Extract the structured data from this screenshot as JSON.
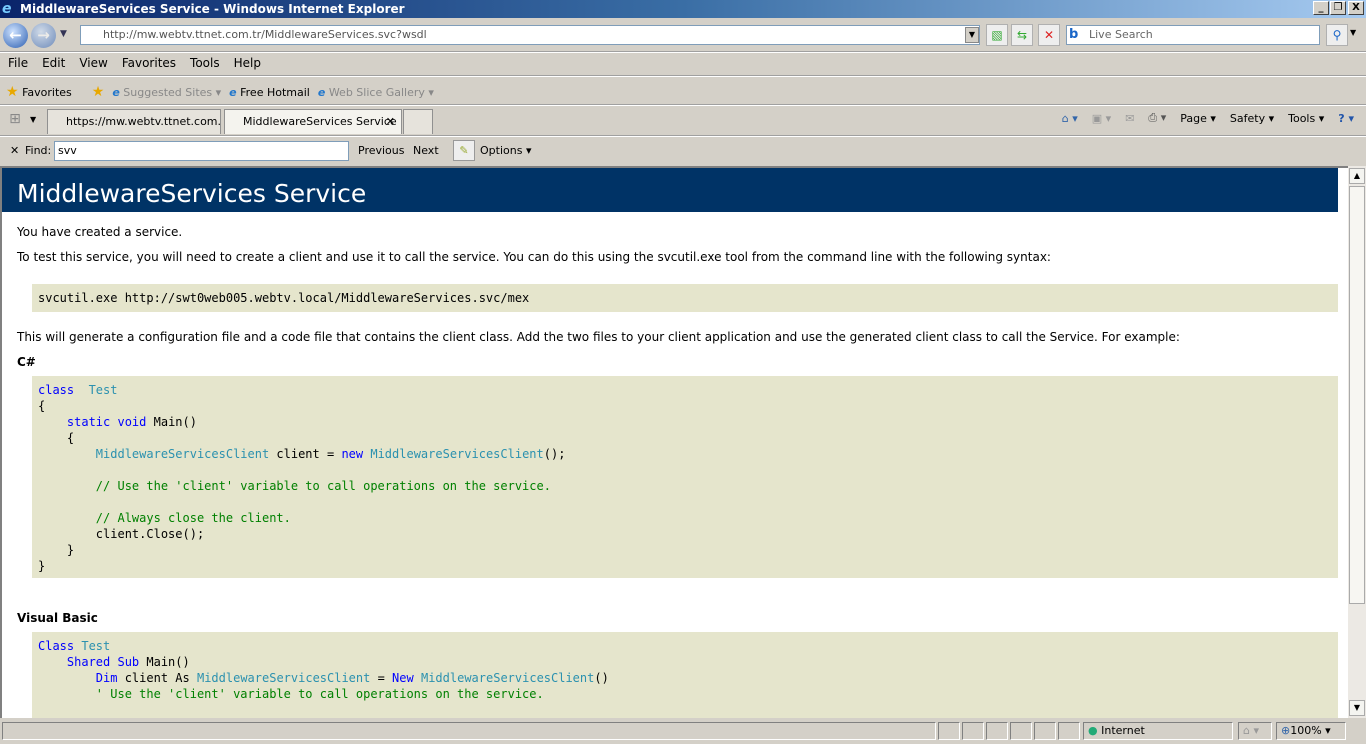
{
  "window": {
    "title": "MiddlewareServices Service - Windows Internet Explorer"
  },
  "address": {
    "url": "http://mw.webtv.ttnet.com.tr/MiddlewareServices.svc?wsdl"
  },
  "search": {
    "placeholder": "Live Search"
  },
  "menu": [
    "File",
    "Edit",
    "View",
    "Favorites",
    "Tools",
    "Help"
  ],
  "favorites": {
    "label": "Favorites",
    "items": [
      "Suggested Sites",
      "Free Hotmail",
      "Web Slice Gallery"
    ]
  },
  "tabs": [
    {
      "label": "https://mw.webtv.ttnet.com..."
    },
    {
      "label": "MiddlewareServices Service",
      "active": true
    }
  ],
  "command_bar": [
    "Page",
    "Safety",
    "Tools"
  ],
  "find": {
    "label": "Find:",
    "value": "svv",
    "previous": "Previous",
    "next": "Next",
    "options": "Options"
  },
  "page": {
    "title": "MiddlewareServices Service",
    "p1": "You have created a service.",
    "p2": "To test this service, you will need to create a client and use it to call the service. You can do this using the svcutil.exe tool from the command line with the following syntax:",
    "cmd": "svcutil.exe http://swt0web005.webtv.local/MiddlewareServices.svc/mex",
    "p3": "This will generate a configuration file and a code file that contains the client class. Add the two files to your client application and use the generated client class to call the Service. For example:",
    "csharp_heading": "C#",
    "csharp_code": [
      [
        [
          "kw",
          "class"
        ],
        [
          "",
          "  "
        ],
        [
          "ty",
          "Test"
        ]
      ],
      [
        [
          "",
          "{"
        ]
      ],
      [
        [
          "",
          "    "
        ],
        [
          "kw",
          "static void"
        ],
        [
          "",
          " Main()"
        ]
      ],
      [
        [
          "",
          "    {"
        ]
      ],
      [
        [
          "",
          "        "
        ],
        [
          "ty",
          "MiddlewareServicesClient"
        ],
        [
          "",
          " client = "
        ],
        [
          "kw",
          "new"
        ],
        [
          "",
          " "
        ],
        [
          "ty",
          "MiddlewareServicesClient"
        ],
        [
          "",
          "();"
        ]
      ],
      [
        [
          "",
          ""
        ]
      ],
      [
        [
          "",
          "        "
        ],
        [
          "cm",
          "// Use the 'client' variable to call operations on the service."
        ]
      ],
      [
        [
          "",
          ""
        ]
      ],
      [
        [
          "",
          "        "
        ],
        [
          "cm",
          "// Always close the client."
        ]
      ],
      [
        [
          "",
          "        client.Close();"
        ]
      ],
      [
        [
          "",
          "    }"
        ]
      ],
      [
        [
          "",
          "}"
        ]
      ]
    ],
    "vb_heading": "Visual Basic",
    "vb_code": [
      [
        [
          "kw",
          "Class"
        ],
        [
          "",
          " "
        ],
        [
          "ty",
          "Test"
        ]
      ],
      [
        [
          "",
          "    "
        ],
        [
          "kw",
          "Shared Sub"
        ],
        [
          "",
          " Main()"
        ]
      ],
      [
        [
          "",
          "        "
        ],
        [
          "kw",
          "Dim"
        ],
        [
          "",
          " client As "
        ],
        [
          "ty",
          "MiddlewareServicesClient"
        ],
        [
          "",
          " = "
        ],
        [
          "kw",
          "New"
        ],
        [
          "",
          " "
        ],
        [
          "ty",
          "MiddlewareServicesClient"
        ],
        [
          "",
          "()"
        ]
      ],
      [
        [
          "",
          "        "
        ],
        [
          "cm",
          "' Use the 'client' variable to call operations on the service."
        ]
      ]
    ]
  },
  "status": {
    "zone": "Internet",
    "zoom": "100%"
  }
}
